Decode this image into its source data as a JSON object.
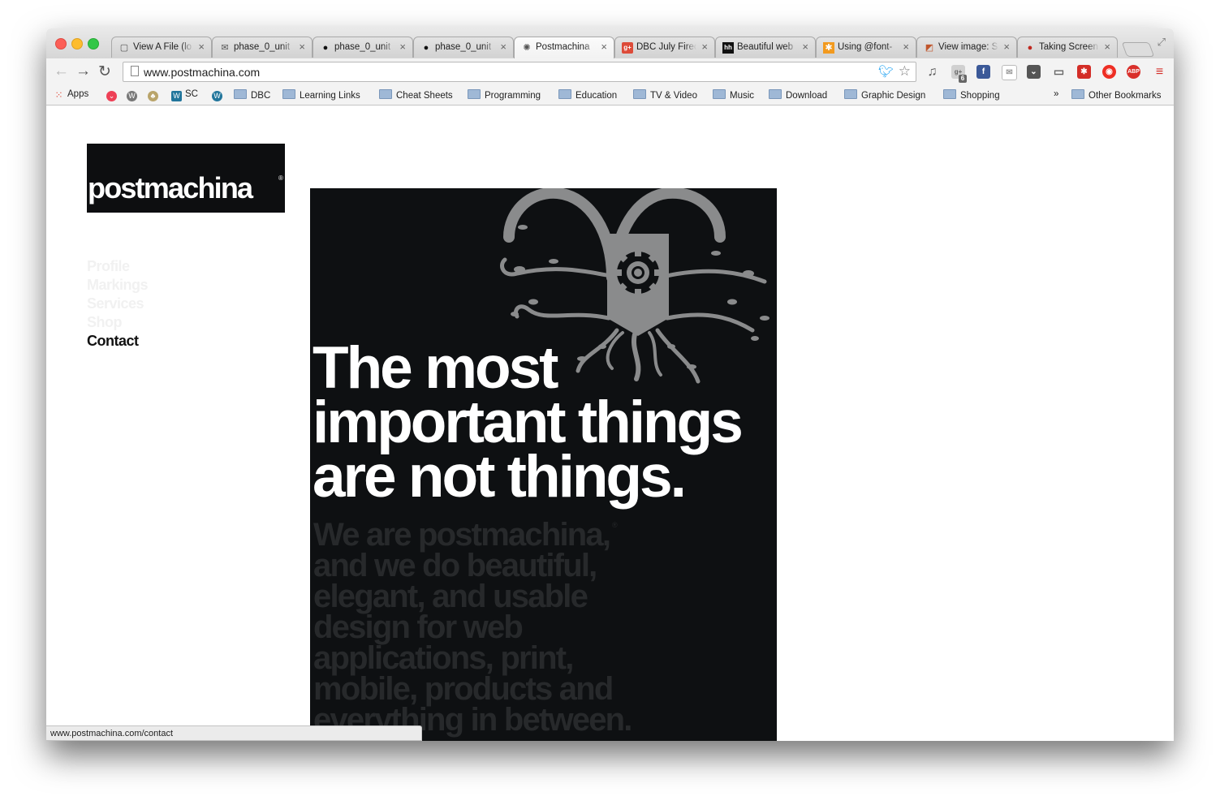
{
  "browser": {
    "tabs": [
      {
        "title": "View A File (lo",
        "favicon": "page-icon"
      },
      {
        "title": "phase_0_unit",
        "favicon": "mail-icon"
      },
      {
        "title": "phase_0_unit",
        "favicon": "github-icon"
      },
      {
        "title": "phase_0_unit",
        "favicon": "github-icon"
      },
      {
        "title": "Postmachina",
        "favicon": "postmachina-icon"
      },
      {
        "title": "DBC July Firec",
        "favicon": "google-plus-icon"
      },
      {
        "title": "Beautiful web",
        "favicon": "hh-icon"
      },
      {
        "title": "Using @font-",
        "favicon": "asterisk-icon"
      },
      {
        "title": "View image: S",
        "favicon": "image-icon"
      },
      {
        "title": "Taking Screen",
        "favicon": "apple-icon"
      }
    ],
    "active_tab": 4,
    "url": "www.postmachina.com",
    "bookmarks": [
      {
        "label": "Apps",
        "icon": "apps-grid-icon"
      },
      {
        "label": "",
        "icon": "pocket-icon"
      },
      {
        "label": "",
        "icon": "wordpress-icon"
      },
      {
        "label": "",
        "icon": "acorn-icon"
      },
      {
        "label": "SC",
        "icon": "wordpress-icon"
      },
      {
        "label": "",
        "icon": "wordpress-icon"
      },
      {
        "label": "DBC",
        "icon": "folder-icon"
      },
      {
        "label": "Learning Links",
        "icon": "folder-icon"
      },
      {
        "label": "Cheat Sheets",
        "icon": "folder-icon"
      },
      {
        "label": "Programming",
        "icon": "folder-icon"
      },
      {
        "label": "Education",
        "icon": "folder-icon"
      },
      {
        "label": "TV & Video",
        "icon": "folder-icon"
      },
      {
        "label": "Music",
        "icon": "folder-icon"
      },
      {
        "label": "Download",
        "icon": "folder-icon"
      },
      {
        "label": "Graphic Design",
        "icon": "folder-icon"
      },
      {
        "label": "Shopping",
        "icon": "folder-icon"
      }
    ],
    "overflow_chevron": "»",
    "other_bookmarks": "Other Bookmarks",
    "extensions": [
      "music-icon",
      "google-plus-icon",
      "facebook-icon",
      "mail-icon",
      "pocket-icon",
      "cast-icon",
      "lastpass-icon",
      "bitly-icon",
      "adblock-icon",
      "menu-icon"
    ],
    "google_plus_badge": "6",
    "adblock_label": "ABP",
    "status_url": "www.postmachina.com/contact"
  },
  "site": {
    "logo": "postmachina",
    "logo_mark": "®",
    "nav": [
      "Profile",
      "Markings",
      "Services",
      "Shop",
      "Contact"
    ],
    "hero_headline": [
      "The most",
      "important things",
      "are not things."
    ],
    "hero_body": [
      "We are postmachina,",
      "and we do beautiful,",
      "elegant, and usable",
      "design for web",
      "applications, print,",
      "mobile, products and",
      "everything in between."
    ],
    "hero_body_mark": "®"
  },
  "colors": {
    "hero_bg": "#0e1012",
    "headline": "#ffffff",
    "body_text": "#27292b",
    "emblem": "#8a8b8c",
    "nav_active": "#111111",
    "nav_inactive": "#f1f1f1"
  }
}
